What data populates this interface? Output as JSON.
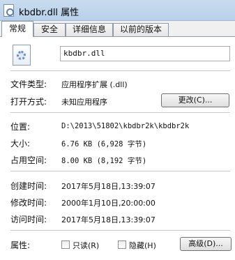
{
  "window": {
    "title": "kbdbr.dll 属性"
  },
  "tabs": [
    {
      "label": "常规",
      "active": true
    },
    {
      "label": "安全",
      "active": false
    },
    {
      "label": "详细信息",
      "active": false
    },
    {
      "label": "以前的版本",
      "active": false
    }
  ],
  "general": {
    "icon": "dll-settings-file-icon",
    "file_name": "kbdbr.dll",
    "type_label": "文件类型:",
    "type_value": "应用程序扩展 (.dll)",
    "opens_with_label": "打开方式:",
    "opens_with_value": "未知应用程序",
    "change_button": "更改(C)...",
    "location_label": "位置:",
    "location_value": "D:\\2013\\51802\\kbdbr2k\\kbdbr2k",
    "size_label": "大小:",
    "size_value": "6.76 KB (6,928 字节)",
    "size_on_disk_label": "占用空间:",
    "size_on_disk_value": "8.00 KB (8,192 字节)",
    "created_label": "创建时间:",
    "created_value": "2017年5月18日,13:39:07",
    "modified_label": "修改时间:",
    "modified_value": "2000年1月10日,20:00:00",
    "accessed_label": "访问时间:",
    "accessed_value": "2017年5月18日,13:39:07",
    "attributes_label": "属性:",
    "readonly_label": "只读(R)",
    "readonly_checked": false,
    "hidden_label": "隐藏(H)",
    "hidden_checked": false,
    "advanced_button": "高级(D)..."
  }
}
